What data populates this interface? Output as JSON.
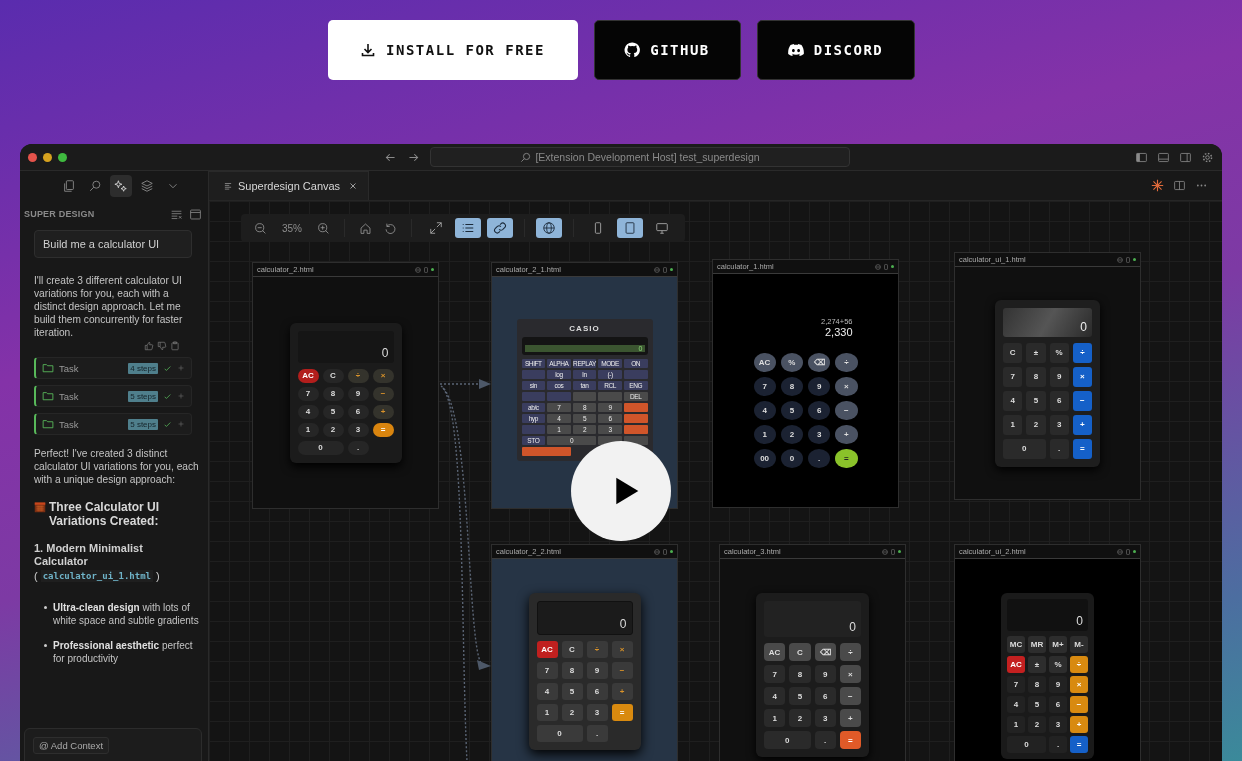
{
  "header_buttons": [
    {
      "label": "INSTALL FOR FREE",
      "kind": "install"
    },
    {
      "label": "GITHUB",
      "kind": "github"
    },
    {
      "label": "DISCORD",
      "kind": "discord"
    }
  ],
  "window": {
    "search": "[Extension Development Host] test_superdesign"
  },
  "sidebar": {
    "tools": [
      {
        "kind": "files",
        "selected": false
      },
      {
        "kind": "search",
        "selected": false
      },
      {
        "kind": "sparkles",
        "selected": true
      },
      {
        "kind": "layers",
        "selected": false
      },
      {
        "kind": "chevron",
        "selected": false
      }
    ],
    "title": "SUPER DESIGN",
    "prompt": "Build me a calculator UI",
    "reply": "I'll create 3 different calculator UI variations for you, each with a distinct design approach. Let me build them concurrently for faster iteration.",
    "tasks": [
      {
        "label": "Task",
        "steps": "4 steps"
      },
      {
        "label": "Task",
        "steps": "5 steps"
      },
      {
        "label": "Task",
        "steps": "5 steps"
      }
    ],
    "summary": "Perfect! I've created 3 distinct calculator UI variations for you, each with a unique design approach:",
    "heading": "Three Calculator UI Variations Created:",
    "subheading": "1. Modern Minimalist Calculator",
    "file_line": [
      "(",
      "calculator_ui_1.html",
      ")"
    ],
    "bullets": [
      "**Ultra-clean design** with lots of white space and subtle gradients",
      "**Professional aesthetic** perfect for productivity"
    ],
    "composer_chip": "@ Add Context"
  },
  "tab": {
    "label": "Superdesign Canvas"
  },
  "toolbar": {
    "zoom": "35%",
    "groups": [
      [
        {
          "kind": "expand",
          "selected": false
        },
        {
          "kind": "list",
          "selected": true
        },
        {
          "kind": "link",
          "selected": true
        }
      ],
      [
        {
          "kind": "globe",
          "selected": true
        }
      ],
      [
        {
          "kind": "phone",
          "selected": false
        },
        {
          "kind": "tablet",
          "selected": true
        },
        {
          "kind": "desktop",
          "selected": false
        }
      ]
    ]
  },
  "frames": [
    {
      "title": "calculator_2.html",
      "calc": {
        "kind": "orange",
        "display": "0",
        "keys": [
          {
            "label": "AC",
            "kind": "clear"
          },
          {
            "label": "C",
            "kind": "num"
          },
          {
            "label": "÷",
            "kind": "op"
          },
          {
            "label": "×",
            "kind": "op"
          },
          {
            "label": "7",
            "kind": "num"
          },
          {
            "label": "8",
            "kind": "num"
          },
          {
            "label": "9",
            "kind": "num"
          },
          {
            "label": "−",
            "kind": "op"
          },
          {
            "label": "4",
            "kind": "num"
          },
          {
            "label": "5",
            "kind": "num"
          },
          {
            "label": "6",
            "kind": "num"
          },
          {
            "label": "+",
            "kind": "op"
          },
          {
            "label": "1",
            "kind": "num"
          },
          {
            "label": "2",
            "kind": "num"
          },
          {
            "label": "3",
            "kind": "num"
          },
          {
            "label": "=",
            "kind": "tall"
          },
          {
            "label": "0",
            "kind": "wide"
          },
          {
            "label": ".",
            "kind": "num"
          }
        ]
      }
    },
    {
      "title": "calculator_2_1.html",
      "calc": {
        "kind": "casio",
        "brand": "CASIO",
        "display": "0",
        "keys": [
          {
            "label": "SHIFT",
            "kind": "fn"
          },
          {
            "label": "ALPHA",
            "kind": "fn"
          },
          {
            "label": "REPLAY",
            "kind": "fn"
          },
          {
            "label": "MODE",
            "kind": "fn"
          },
          {
            "label": "ON",
            "kind": "fn"
          },
          {
            "kind": "fn"
          },
          {
            "label": "log",
            "kind": "fn"
          },
          {
            "label": "ln",
            "kind": "fn"
          },
          {
            "label": "(-)",
            "kind": "fn"
          },
          {
            "kind": "fn"
          },
          {
            "label": "sin",
            "kind": "fn"
          },
          {
            "label": "cos",
            "kind": "fn"
          },
          {
            "label": "tan",
            "kind": "fn"
          },
          {
            "label": "RCL",
            "kind": "fn"
          },
          {
            "label": "ENG",
            "kind": "fn"
          },
          {
            "kind": "fn"
          },
          {
            "kind": "fn"
          },
          {
            "kind": "num"
          },
          {
            "kind": "num"
          },
          {
            "label": "DEL",
            "kind": "num"
          },
          {
            "label": "ab/c",
            "kind": "fn"
          },
          {
            "label": "7",
            "kind": "num"
          },
          {
            "label": "8",
            "kind": "num"
          },
          {
            "label": "9",
            "kind": "num"
          },
          {
            "kind": "op"
          },
          {
            "label": "hyp",
            "kind": "fn"
          },
          {
            "label": "4",
            "kind": "num"
          },
          {
            "label": "5",
            "kind": "num"
          },
          {
            "label": "6",
            "kind": "num"
          },
          {
            "kind": "op"
          },
          {
            "kind": "fn"
          },
          {
            "label": "1",
            "kind": "num"
          },
          {
            "label": "2",
            "kind": "num"
          },
          {
            "label": "3",
            "kind": "num"
          },
          {
            "kind": "op"
          },
          {
            "label": "STO",
            "kind": "fn"
          },
          {
            "label": "0",
            "kind": "wide"
          },
          {
            "kind": "num"
          },
          {
            "kind": "num"
          },
          {
            "kind": "wideeq"
          }
        ]
      }
    },
    {
      "title": "calculator_1.html",
      "calc": {
        "kind": "circle",
        "sub": "2,274+56",
        "display": "2,330",
        "keys": [
          {
            "label": "AC",
            "kind": "fn"
          },
          {
            "label": "%",
            "kind": "fn"
          },
          {
            "label": "⌫",
            "kind": "fn"
          },
          {
            "label": "÷",
            "kind": "op"
          },
          {
            "label": "7",
            "kind": "num"
          },
          {
            "label": "8",
            "kind": "num"
          },
          {
            "label": "9",
            "kind": "num"
          },
          {
            "label": "×",
            "kind": "op"
          },
          {
            "label": "4",
            "kind": "num"
          },
          {
            "label": "5",
            "kind": "num"
          },
          {
            "label": "6",
            "kind": "num"
          },
          {
            "label": "−",
            "kind": "op"
          },
          {
            "label": "1",
            "kind": "num"
          },
          {
            "label": "2",
            "kind": "num"
          },
          {
            "label": "3",
            "kind": "num"
          },
          {
            "label": "+",
            "kind": "op"
          },
          {
            "label": "00",
            "kind": "num"
          },
          {
            "label": "0",
            "kind": "num"
          },
          {
            "label": ".",
            "kind": "num"
          },
          {
            "label": "=",
            "kind": "eq"
          }
        ]
      }
    },
    {
      "title": "calculator_ui_1.html",
      "calc": {
        "kind": "blue",
        "display": "0",
        "keys": [
          {
            "label": "C",
            "kind": "num"
          },
          {
            "label": "±",
            "kind": "num"
          },
          {
            "label": "%",
            "kind": "num"
          },
          {
            "label": "÷",
            "kind": "op"
          },
          {
            "label": "7",
            "kind": "num"
          },
          {
            "label": "8",
            "kind": "num"
          },
          {
            "label": "9",
            "kind": "num"
          },
          {
            "label": "×",
            "kind": "op"
          },
          {
            "label": "4",
            "kind": "num"
          },
          {
            "label": "5",
            "kind": "num"
          },
          {
            "label": "6",
            "kind": "num"
          },
          {
            "label": "−",
            "kind": "op"
          },
          {
            "label": "1",
            "kind": "num"
          },
          {
            "label": "2",
            "kind": "num"
          },
          {
            "label": "3",
            "kind": "num"
          },
          {
            "label": "+",
            "kind": "op"
          },
          {
            "label": "0",
            "kind": "wide"
          },
          {
            "label": ".",
            "kind": "num"
          },
          {
            "label": "=",
            "kind": "op"
          }
        ]
      }
    },
    {
      "title": "calculator_2_2.html",
      "calc": {
        "kind": "orange3d",
        "display": "0",
        "keys": [
          {
            "label": "AC",
            "kind": "clear"
          },
          {
            "label": "C",
            "kind": "num"
          },
          {
            "label": "÷",
            "kind": "op"
          },
          {
            "label": "×",
            "kind": "op"
          },
          {
            "label": "7",
            "kind": "num"
          },
          {
            "label": "8",
            "kind": "num"
          },
          {
            "label": "9",
            "kind": "num"
          },
          {
            "label": "−",
            "kind": "op"
          },
          {
            "label": "4",
            "kind": "num"
          },
          {
            "label": "5",
            "kind": "num"
          },
          {
            "label": "6",
            "kind": "num"
          },
          {
            "label": "+",
            "kind": "op"
          },
          {
            "label": "1",
            "kind": "num"
          },
          {
            "label": "2",
            "kind": "num"
          },
          {
            "label": "3",
            "kind": "num"
          },
          {
            "label": "=",
            "kind": "tall"
          },
          {
            "label": "0",
            "kind": "wide"
          },
          {
            "label": ".",
            "kind": "num"
          }
        ]
      }
    },
    {
      "title": "calculator_3.html",
      "calc": {
        "kind": "redorange",
        "display": "0",
        "keys": [
          {
            "label": "AC",
            "kind": "fn"
          },
          {
            "label": "C",
            "kind": "fn"
          },
          {
            "label": "⌫",
            "kind": "fn"
          },
          {
            "label": "÷",
            "kind": "fn"
          },
          {
            "label": "7",
            "kind": "num"
          },
          {
            "label": "8",
            "kind": "num"
          },
          {
            "label": "9",
            "kind": "num"
          },
          {
            "label": "×",
            "kind": "fn"
          },
          {
            "label": "4",
            "kind": "num"
          },
          {
            "label": "5",
            "kind": "num"
          },
          {
            "label": "6",
            "kind": "num"
          },
          {
            "label": "−",
            "kind": "fn"
          },
          {
            "label": "1",
            "kind": "num"
          },
          {
            "label": "2",
            "kind": "num"
          },
          {
            "label": "3",
            "kind": "num"
          },
          {
            "label": "+",
            "kind": "fn"
          },
          {
            "label": "0",
            "kind": "wide"
          },
          {
            "label": ".",
            "kind": "num"
          },
          {
            "label": "=",
            "kind": "eq"
          }
        ]
      }
    },
    {
      "title": "calculator_ui_2.html",
      "calc": {
        "kind": "memory",
        "display": "0",
        "keys": [
          {
            "label": "MC",
            "kind": "fn"
          },
          {
            "label": "MR",
            "kind": "fn"
          },
          {
            "label": "M+",
            "kind": "fn"
          },
          {
            "label": "M-",
            "kind": "fn"
          },
          {
            "label": "AC",
            "kind": "clear"
          },
          {
            "label": "±",
            "kind": "fn"
          },
          {
            "label": "%",
            "kind": "fn"
          },
          {
            "label": "÷",
            "kind": "op"
          },
          {
            "label": "7",
            "kind": "num"
          },
          {
            "label": "8",
            "kind": "num"
          },
          {
            "label": "9",
            "kind": "num"
          },
          {
            "label": "×",
            "kind": "op"
          },
          {
            "label": "4",
            "kind": "num"
          },
          {
            "label": "5",
            "kind": "num"
          },
          {
            "label": "6",
            "kind": "num"
          },
          {
            "label": "−",
            "kind": "op"
          },
          {
            "label": "1",
            "kind": "num"
          },
          {
            "label": "2",
            "kind": "num"
          },
          {
            "label": "3",
            "kind": "num"
          },
          {
            "label": "+",
            "kind": "op"
          },
          {
            "label": "0",
            "kind": "wide"
          },
          {
            "label": ".",
            "kind": "num"
          },
          {
            "label": "=",
            "kind": "eq"
          }
        ]
      }
    }
  ]
}
